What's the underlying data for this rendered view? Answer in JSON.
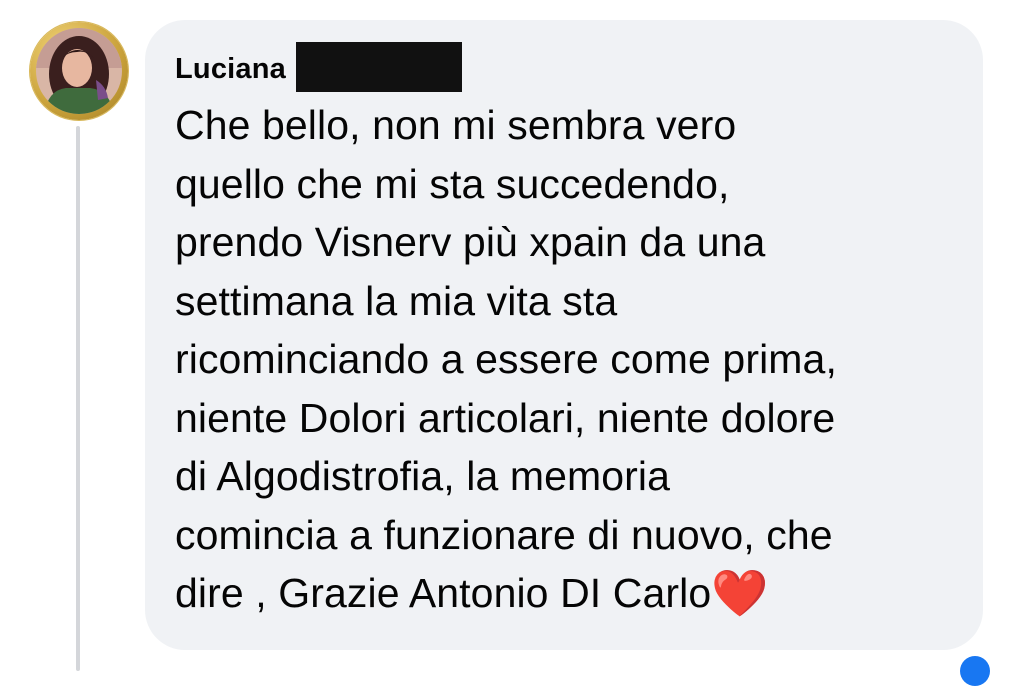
{
  "comment": {
    "author": "Luciana",
    "text": "Che bello, non mi sembra vero\nquello che mi sta succedendo,\nprendo Visnerv più xpain da una\nsettimana la mia vita sta\nricominciando a essere come prima,\nniente Dolori articolari, niente dolore\ndi Algodistrofia, la memoria\ncomincia a funzionare di nuovo, che\ndire , Grazie Antonio DI Carlo",
    "emoji": "❤️"
  },
  "icons": {
    "avatar": "profile-avatar",
    "heart": "red-heart-emoji",
    "corner_badge": "reaction-badge-icon"
  },
  "colors": {
    "bubble_background": "#f0f2f5",
    "text": "#050505",
    "heart": "#e0161b",
    "badge": "#1877f2"
  }
}
